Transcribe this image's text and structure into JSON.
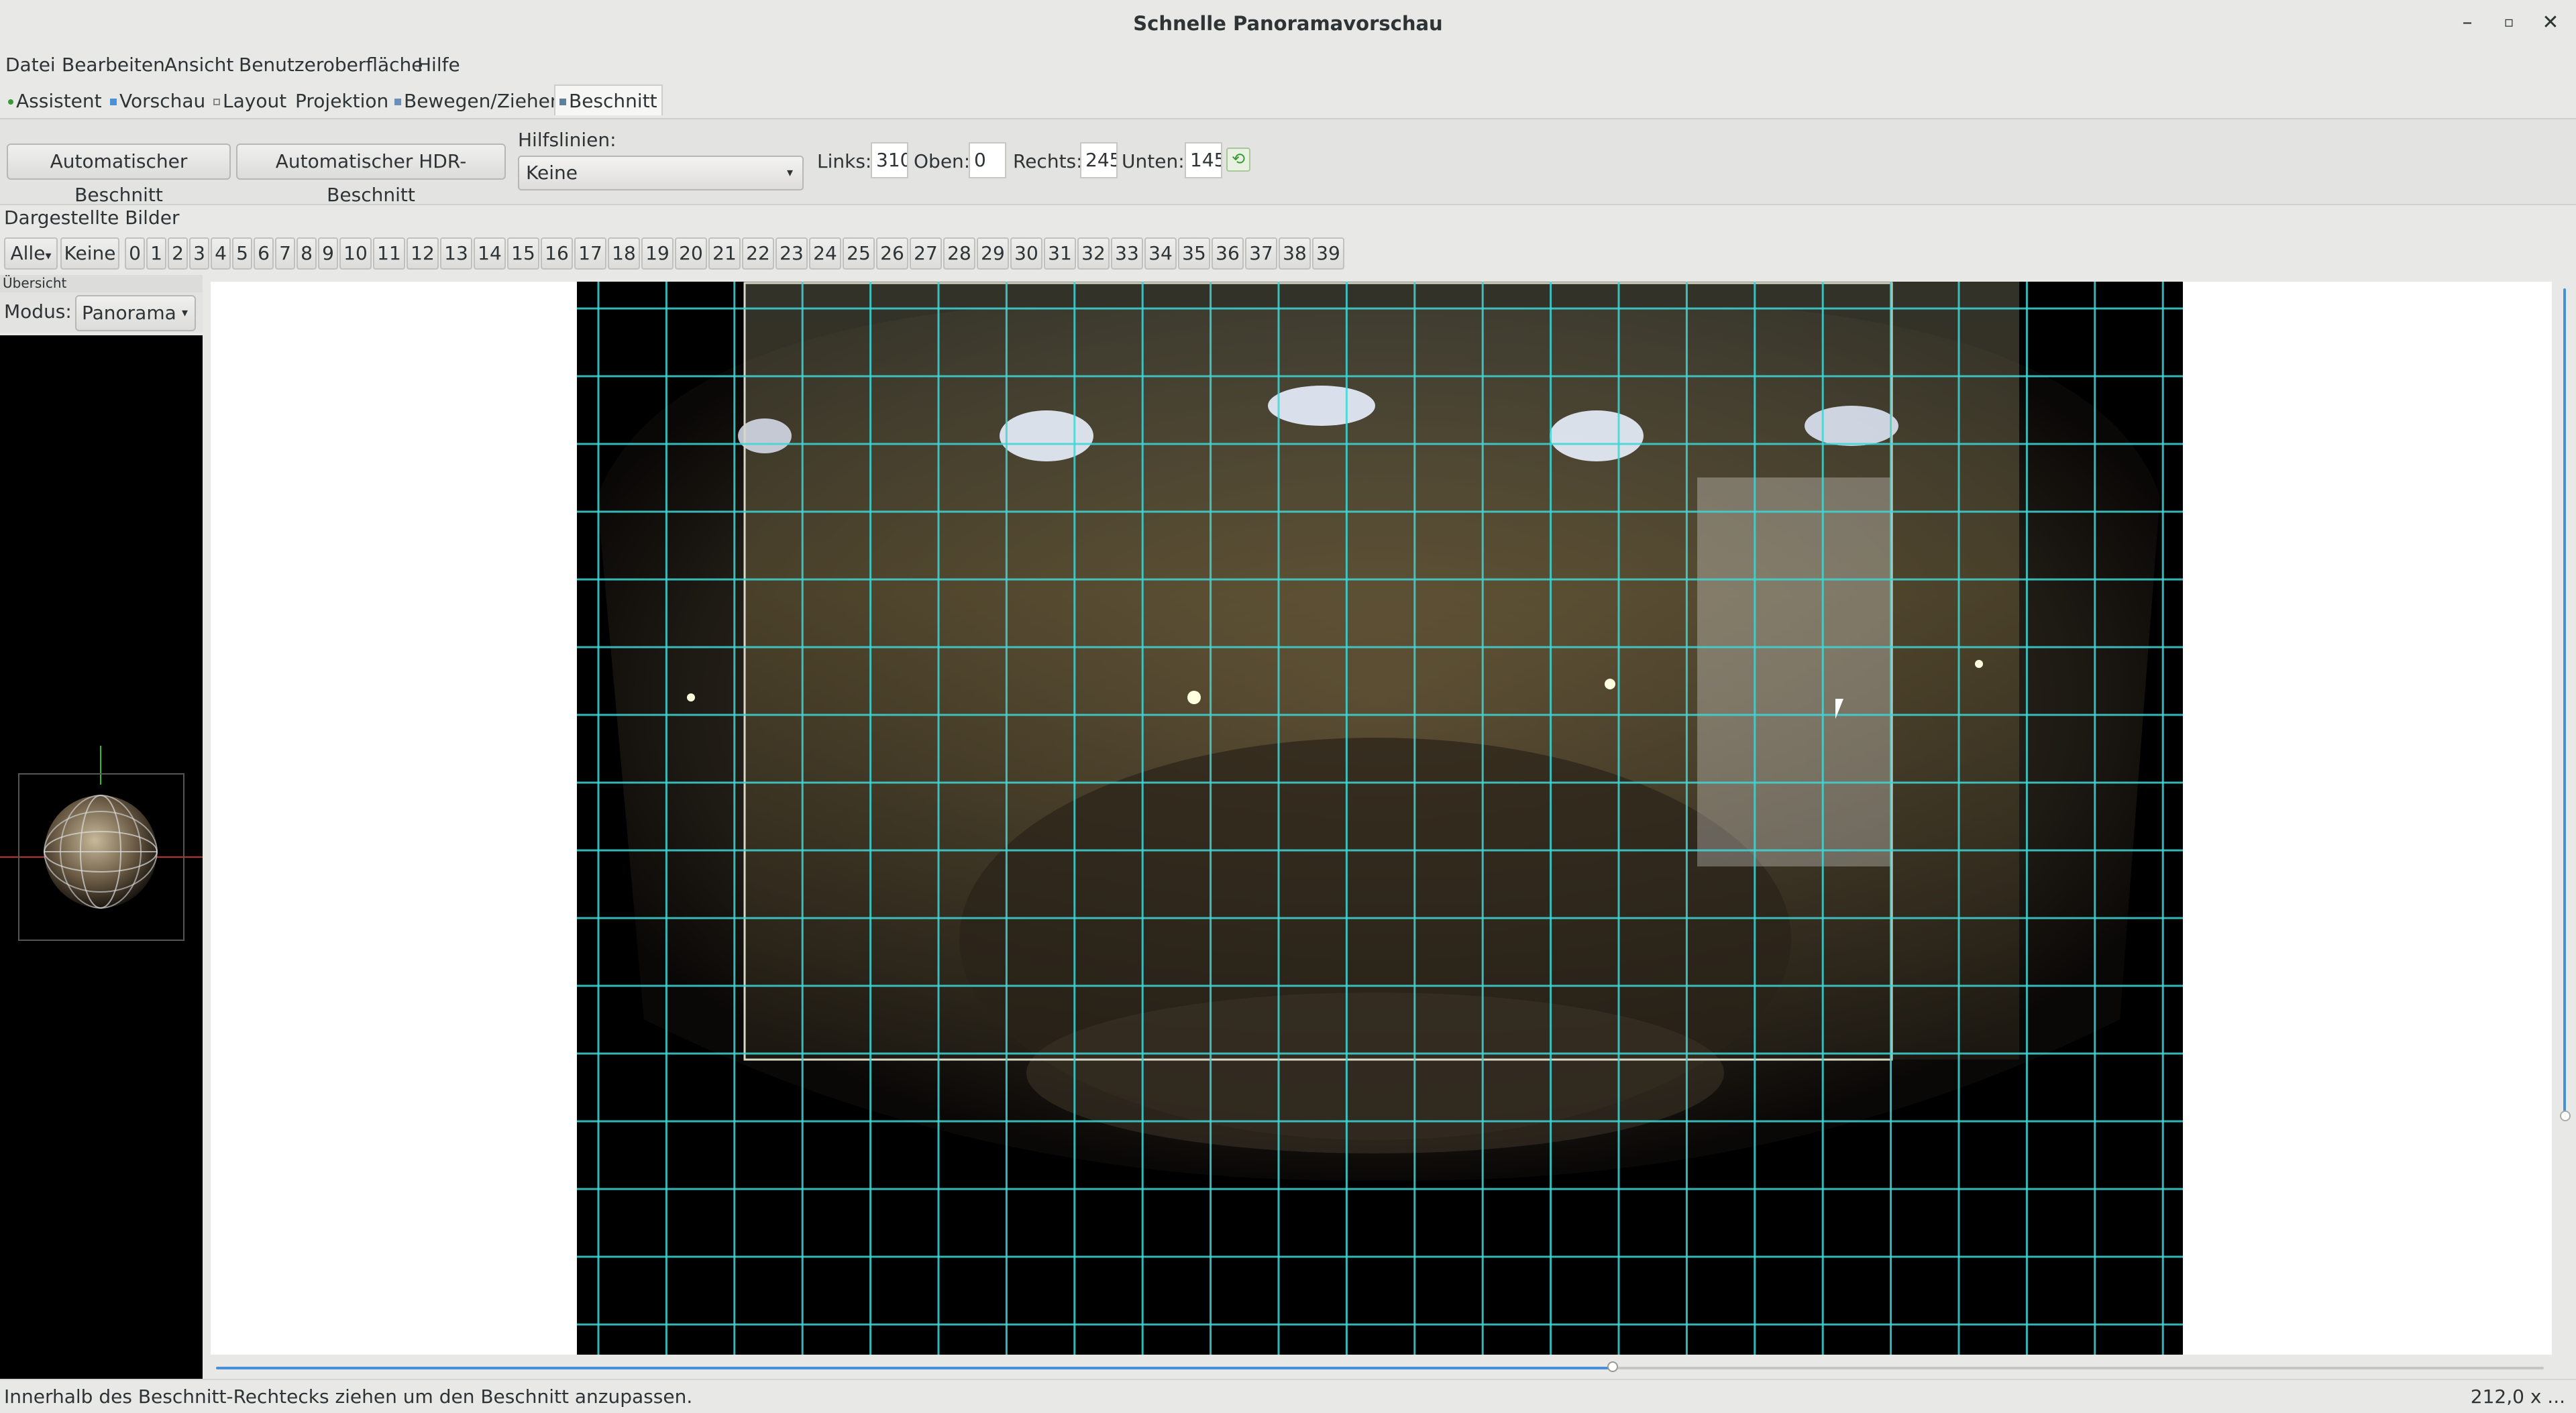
{
  "window": {
    "title": "Schnelle Panoramavorschau",
    "buttons": {
      "minimize": "–",
      "maximize": "▫",
      "close": "✕"
    }
  },
  "menubar": [
    "Datei",
    "Bearbeiten",
    "Ansicht",
    "Benutzeroberfläche",
    "Hilfe"
  ],
  "tabs": [
    {
      "label": "Assistent",
      "active": false
    },
    {
      "label": "Vorschau",
      "active": false
    },
    {
      "label": "Layout",
      "active": false
    },
    {
      "label": "Projektion",
      "active": false
    },
    {
      "label": "Bewegen/Ziehen",
      "active": false
    },
    {
      "label": "Beschnitt",
      "active": true
    }
  ],
  "crop": {
    "auto_crop": "Automatischer Beschnitt",
    "auto_hdr_crop": "Automatischer HDR-Beschnitt",
    "guides_label": "Hilfslinien:",
    "guides_value": "Keine",
    "left_label": "Links:",
    "left_value": "310",
    "top_label": "Oben:",
    "top_value": "0",
    "right_label": "Rechts:",
    "right_value": "245",
    "bottom_label": "Unten:",
    "bottom_value": "145"
  },
  "images": {
    "label": "Dargestellte Bilder",
    "all": "Alle",
    "none": "Keine",
    "numbers": [
      "0",
      "1",
      "2",
      "3",
      "4",
      "5",
      "6",
      "7",
      "8",
      "9",
      "10",
      "11",
      "12",
      "13",
      "14",
      "15",
      "16",
      "17",
      "18",
      "19",
      "20",
      "21",
      "22",
      "23",
      "24",
      "25",
      "26",
      "27",
      "28",
      "29",
      "30",
      "31",
      "32",
      "33",
      "34",
      "35",
      "36",
      "37",
      "38",
      "39"
    ]
  },
  "overview": {
    "title": "Übersicht",
    "mode_label": "Modus:",
    "mode_value": "Panorama"
  },
  "slider": {
    "fraction": 0.6
  },
  "status": {
    "message": "Innerhalb des Beschnitt-Rechtecks ziehen um den Beschnitt anzupassen.",
    "right": "212,0 x ..."
  },
  "colors": {
    "grid": "#3fd6d6",
    "accent": "#4a90d9",
    "green": "#3a9a3a"
  }
}
